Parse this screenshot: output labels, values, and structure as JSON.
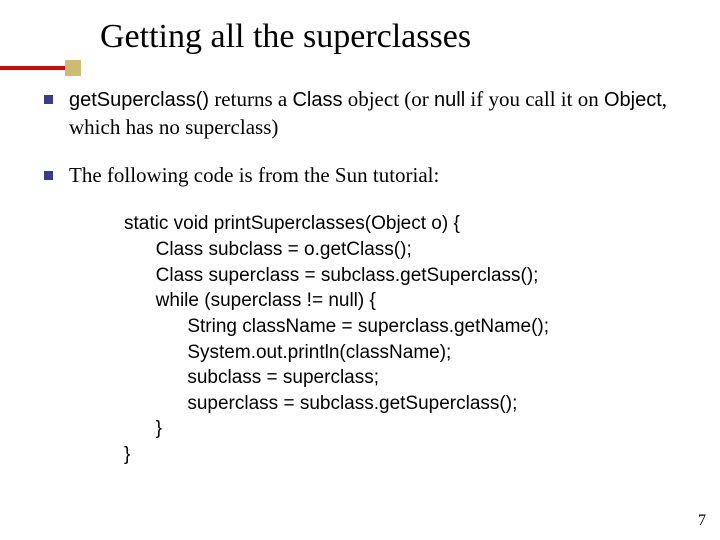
{
  "title": "Getting all the superclasses",
  "bullets": [
    {
      "parts": [
        "getSuperclass()",
        " returns a ",
        "Class",
        " object (or ",
        "null",
        " if you call it on ",
        "Object",
        ", which has no superclass)"
      ]
    },
    {
      "text": "The following code is from the Sun tutorial:"
    }
  ],
  "code": "static void printSuperclasses(Object o) {\n      Class subclass = o.getClass();\n      Class superclass = subclass.getSuperclass();\n      while (superclass != null) {\n            String className = superclass.getName();\n            System.out.println(className);\n            subclass = superclass;\n            superclass = subclass.getSuperclass();\n      }\n}",
  "page": "7"
}
